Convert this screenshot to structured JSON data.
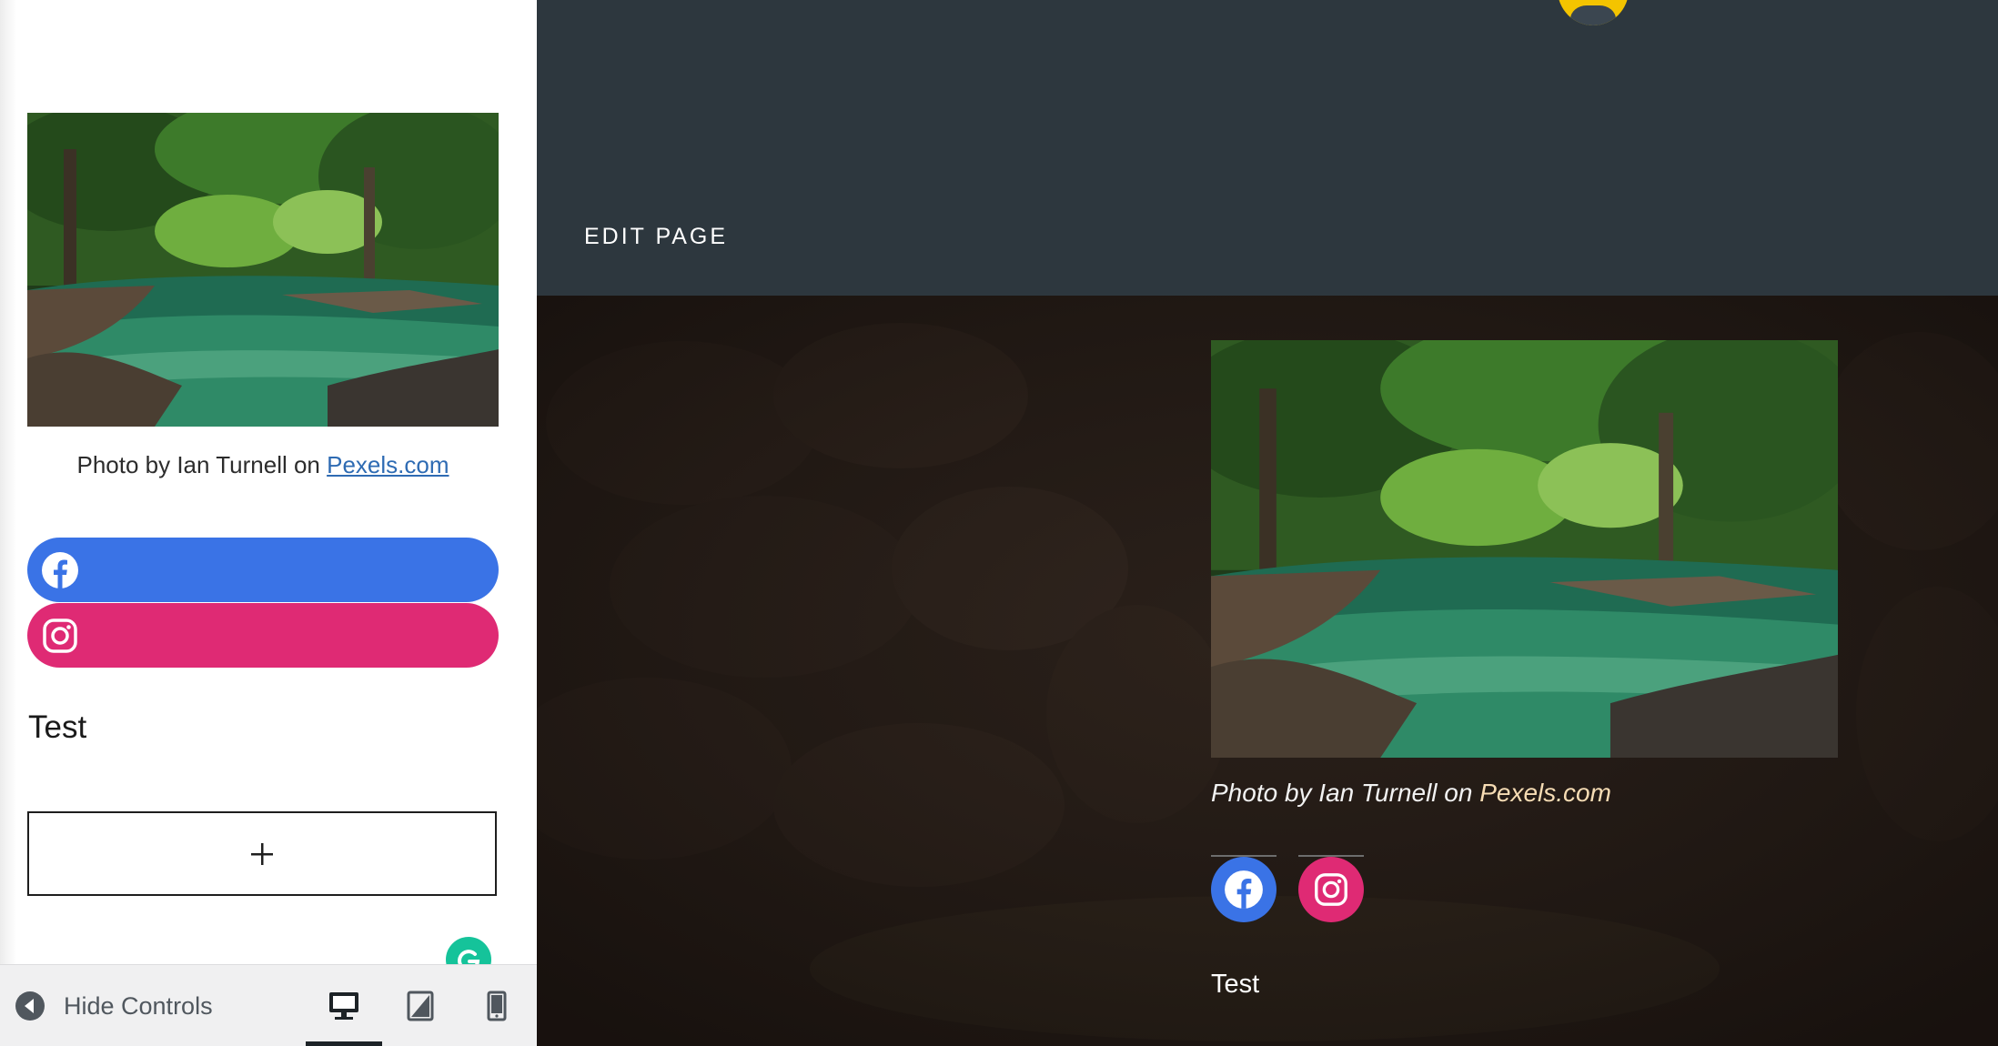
{
  "sidebar": {
    "image_caption_prefix": "Photo by Ian Turnell on ",
    "image_caption_link": "Pexels.com",
    "social": [
      {
        "icon": "facebook-icon",
        "color": "#3a73e6"
      },
      {
        "icon": "instagram-icon",
        "color": "#df2a74"
      }
    ],
    "heading": "Test",
    "add_block_label": "+",
    "footer": {
      "hide_controls_label": "Hide Controls",
      "devices": [
        "desktop",
        "tablet",
        "mobile"
      ],
      "active_device": "desktop"
    }
  },
  "preview": {
    "header": {
      "edit_page_label": "EDIT PAGE"
    },
    "image_caption_prefix": "Photo by Ian Turnell on ",
    "image_caption_link": "Pexels.com",
    "social": [
      {
        "icon": "facebook-icon",
        "color": "#3a73e6"
      },
      {
        "icon": "instagram-icon",
        "color": "#df2a74"
      }
    ],
    "heading": "Test"
  },
  "colors": {
    "header_bg": "#2d373e",
    "content_bg": "#221a15",
    "facebook": "#3a73e6",
    "instagram": "#df2a74"
  }
}
